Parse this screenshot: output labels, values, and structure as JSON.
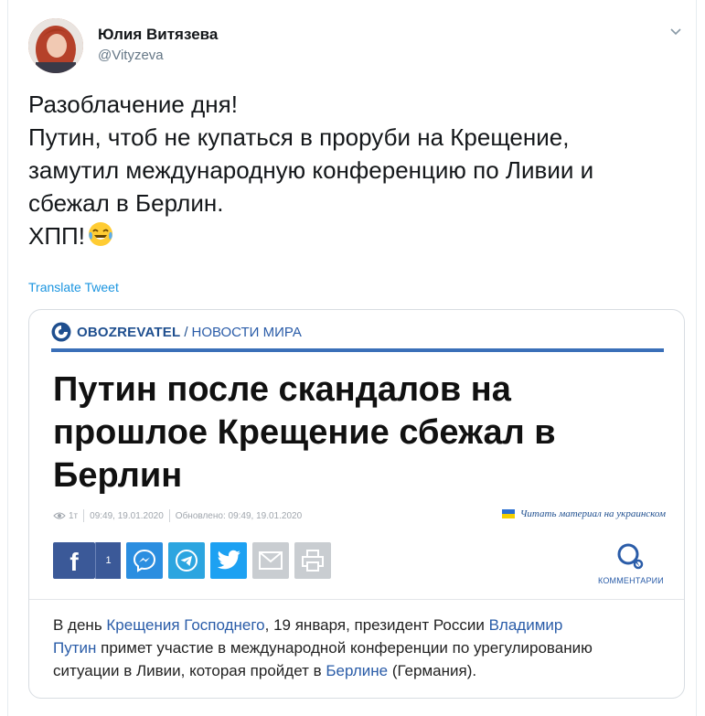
{
  "tweet": {
    "display_name": "Юлия Витязева",
    "handle": "@Vityzeva",
    "text_lines": [
      "Разоблачение дня!",
      "Путин, чтоб не купаться в проруби на Крещение,",
      "замутил международную конференцию по Ливии и",
      "сбежал в Берлин.",
      "ХПП!"
    ],
    "emoji": "face-with-tears-of-joy",
    "translate_label": "Translate Tweet"
  },
  "card": {
    "brand": "OBOZREVATEL",
    "brand_sep": "/",
    "section": "НОВОСТИ МИРА",
    "headline_lines": [
      "Путин после скандалов на",
      "прошлое Крещение сбежал в",
      "Берлин"
    ],
    "meta": {
      "views": "1т",
      "published": "09:49, 19.01.2020",
      "updated": "Обновлено: 09:49, 19.01.2020",
      "ukr_link": "Читать материал на украинском"
    },
    "share": {
      "fb_label": "f",
      "fb_count": "1",
      "comments_label": "КОММЕНТАРИИ"
    },
    "body": {
      "l1_pre": "В день ",
      "l1_link": "Крещения Господнего",
      "l1_mid": ", 19 января, президент России ",
      "l1_link2": "Владимир",
      "l2_link": "Путин",
      "l2_rest": " примет участие в международной конференции по урегулированию",
      "l3_pre": "ситуации в Ливии, которая пройдет в ",
      "l3_link": "Берлине",
      "l3_post": " (Германия)."
    }
  },
  "colors": {
    "brand_blue": "#1f4f8f",
    "link_blue": "#1b95e0",
    "facebook": "#3b5998",
    "twitter": "#1da1f2",
    "telegram": "#2ca5e0",
    "messenger": "#2b8ee0"
  }
}
